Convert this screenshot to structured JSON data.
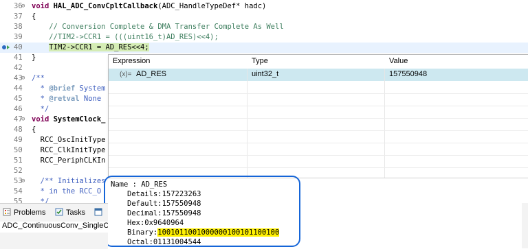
{
  "editor": {
    "lines": [
      {
        "num": "36",
        "fold": "⊖",
        "parts": [
          {
            "t": "void ",
            "c": "kw"
          },
          {
            "t": "HAL_ADC_ConvCpltCallback",
            "c": "fn"
          },
          {
            "t": "(ADC_HandleTypeDef* hadc)",
            "c": ""
          }
        ]
      },
      {
        "num": "37",
        "parts": [
          {
            "t": "{",
            "c": ""
          }
        ]
      },
      {
        "num": "38",
        "parts": [
          {
            "t": "    // Conversion Complete & DMA Transfer Complete As Well",
            "c": "cm"
          }
        ]
      },
      {
        "num": "39",
        "parts": [
          {
            "t": "    //TIM2->CCR1 = (((uint16_t)AD_RES)<<4);",
            "c": "cm"
          }
        ]
      },
      {
        "num": "40",
        "hl": true,
        "marker": true,
        "parts": [
          {
            "t": "    ",
            "c": ""
          },
          {
            "t": "TIM2->CCR1 = AD_RES<<4;",
            "c": "hlsel"
          }
        ]
      },
      {
        "num": "41",
        "parts": [
          {
            "t": "}",
            "c": ""
          }
        ]
      },
      {
        "num": "42",
        "parts": [
          {
            "t": "",
            "c": ""
          }
        ]
      },
      {
        "num": "43",
        "fold": "⊖",
        "parts": [
          {
            "t": "/**",
            "c": "jd"
          }
        ]
      },
      {
        "num": "44",
        "parts": [
          {
            "t": "  * ",
            "c": "jd"
          },
          {
            "t": "@brief",
            "c": "tag"
          },
          {
            "t": " System",
            "c": "jd"
          }
        ]
      },
      {
        "num": "45",
        "parts": [
          {
            "t": "  * ",
            "c": "jd"
          },
          {
            "t": "@retval",
            "c": "tag"
          },
          {
            "t": " None",
            "c": "jd"
          }
        ]
      },
      {
        "num": "46",
        "parts": [
          {
            "t": "  */",
            "c": "jd"
          }
        ]
      },
      {
        "num": "47",
        "fold": "⊖",
        "parts": [
          {
            "t": "void ",
            "c": "kw"
          },
          {
            "t": "SystemClock_",
            "c": "fn"
          }
        ]
      },
      {
        "num": "48",
        "parts": [
          {
            "t": "{",
            "c": ""
          }
        ]
      },
      {
        "num": "49",
        "parts": [
          {
            "t": "  RCC_OscInitType",
            "c": ""
          }
        ]
      },
      {
        "num": "50",
        "parts": [
          {
            "t": "  RCC_ClkInitType",
            "c": ""
          }
        ]
      },
      {
        "num": "51",
        "parts": [
          {
            "t": "  RCC_PeriphCLKIn",
            "c": ""
          }
        ]
      },
      {
        "num": "52",
        "parts": [
          {
            "t": "",
            "c": ""
          }
        ]
      },
      {
        "num": "53",
        "fold": "⊖",
        "parts": [
          {
            "t": "  /** Initializes",
            "c": "jd"
          }
        ]
      },
      {
        "num": "54",
        "parts": [
          {
            "t": "  * in the RCC_O",
            "c": "jd"
          }
        ]
      },
      {
        "num": "55",
        "parts": [
          {
            "t": "  */",
            "c": "jd"
          }
        ]
      }
    ]
  },
  "expressions": {
    "headers": {
      "expression": "Expression",
      "type": "Type",
      "value": "Value"
    },
    "rows": [
      {
        "icon": "(x)=",
        "expression": "AD_RES",
        "type": "uint32_t",
        "value": "157550948"
      }
    ]
  },
  "details": {
    "name": "Name : AD_RES",
    "lines": [
      "Details:157223263",
      "Default:157550948",
      "Decimal:157550948",
      "Hex:0x9640964",
      "Binary:1001011001000000100101100100",
      "Octal:01131004544"
    ]
  },
  "bottom": {
    "tabs": [
      {
        "label": "Problems",
        "icon": "problems-icon"
      },
      {
        "label": "Tasks",
        "icon": "tasks-icon"
      }
    ],
    "status": "ADC_ContinuousConv_SingleC"
  },
  "colors": {
    "highlight_oval": "#1565d8",
    "binary_highlight": "#fff000",
    "selected_row": "#cde8f0"
  }
}
